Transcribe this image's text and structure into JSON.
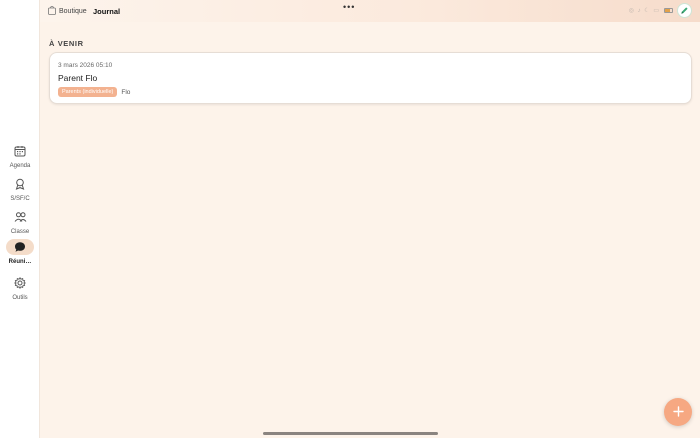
{
  "topbar": {
    "breadcrumb_store": "Boutique",
    "breadcrumb_current": "Journal",
    "more_menu": "•••"
  },
  "sidebar": {
    "items": [
      {
        "label": "Agenda",
        "icon": "calendar-icon",
        "active": false
      },
      {
        "label": "S/SF/C",
        "icon": "award-icon",
        "active": false
      },
      {
        "label": "Classe",
        "icon": "group-icon",
        "active": false
      },
      {
        "label": "Réuni…",
        "icon": "chat-bubble-icon",
        "active": true
      },
      {
        "label": "Outils",
        "icon": "gear-icon",
        "active": false
      }
    ]
  },
  "main": {
    "section_title": "À VENIR",
    "meetings": [
      {
        "date": "3 mars 2026  05:10",
        "title": "Parent Flo",
        "tag": "Parents (individuelle)",
        "person": "Flo"
      }
    ]
  },
  "colors": {
    "background": "#fdf3ea",
    "accent": "#f6a882",
    "tag": "#f3b290",
    "active_rail": "#f4dcc9"
  },
  "fab": {
    "icon": "plus-icon"
  }
}
